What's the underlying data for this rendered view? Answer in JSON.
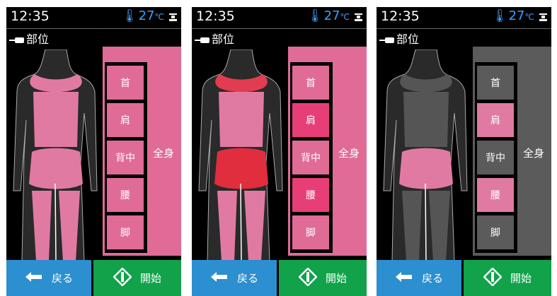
{
  "screens": [
    {
      "status": {
        "time": "12:35",
        "temperature": "27",
        "temp_unit": "℃"
      },
      "header": {
        "title": "部位"
      },
      "parts": [
        "首",
        "肩",
        "背中",
        "腰",
        "脚"
      ],
      "whole_body_label": "全身",
      "buttons": {
        "back": "戻る",
        "start": "開始"
      },
      "state": {
        "whole_body_color": "#e06b97",
        "part_colors": [
          "#e06b97",
          "#e06b97",
          "#e06b97",
          "#e06b97",
          "#e06b97"
        ],
        "figure_colors": {
          "neck": "#e07aa3",
          "back": "#e07aa3",
          "hips": "#e07aa3",
          "legs": "#e07aa3"
        }
      }
    },
    {
      "status": {
        "time": "12:35",
        "temperature": "27",
        "temp_unit": "℃"
      },
      "header": {
        "title": "部位"
      },
      "parts": [
        "首",
        "肩",
        "背中",
        "腰",
        "脚"
      ],
      "whole_body_label": "全身",
      "buttons": {
        "back": "戻る",
        "start": "開始"
      },
      "state": {
        "whole_body_color": "#e06b97",
        "part_colors": [
          "#e06b97",
          "#e83e78",
          "#e06b97",
          "#e83e78",
          "#e06b97"
        ],
        "figure_colors": {
          "neck": "#e23c50",
          "back": "#e07aa3",
          "hips": "#e02e3e",
          "legs": "#e07aa3"
        }
      }
    },
    {
      "status": {
        "time": "12:35",
        "temperature": "27",
        "temp_unit": "℃"
      },
      "header": {
        "title": "部位"
      },
      "parts": [
        "首",
        "肩",
        "背中",
        "腰",
        "脚"
      ],
      "whole_body_label": "全身",
      "buttons": {
        "back": "戻る",
        "start": "開始"
      },
      "state": {
        "whole_body_color": "#5b5b5b",
        "part_colors": [
          "#5b5b5b",
          "#e07aa3",
          "#5b5b5b",
          "#e07aa3",
          "#5b5b5b"
        ],
        "figure_colors": {
          "neck": "#555555",
          "back": "#555555",
          "hips": "#e07aa3",
          "legs": "#555555"
        }
      }
    }
  ],
  "colors": {
    "temperature": "#3aa0ff",
    "back_button": "#2b8fd0",
    "start_button": "#11a24a"
  }
}
